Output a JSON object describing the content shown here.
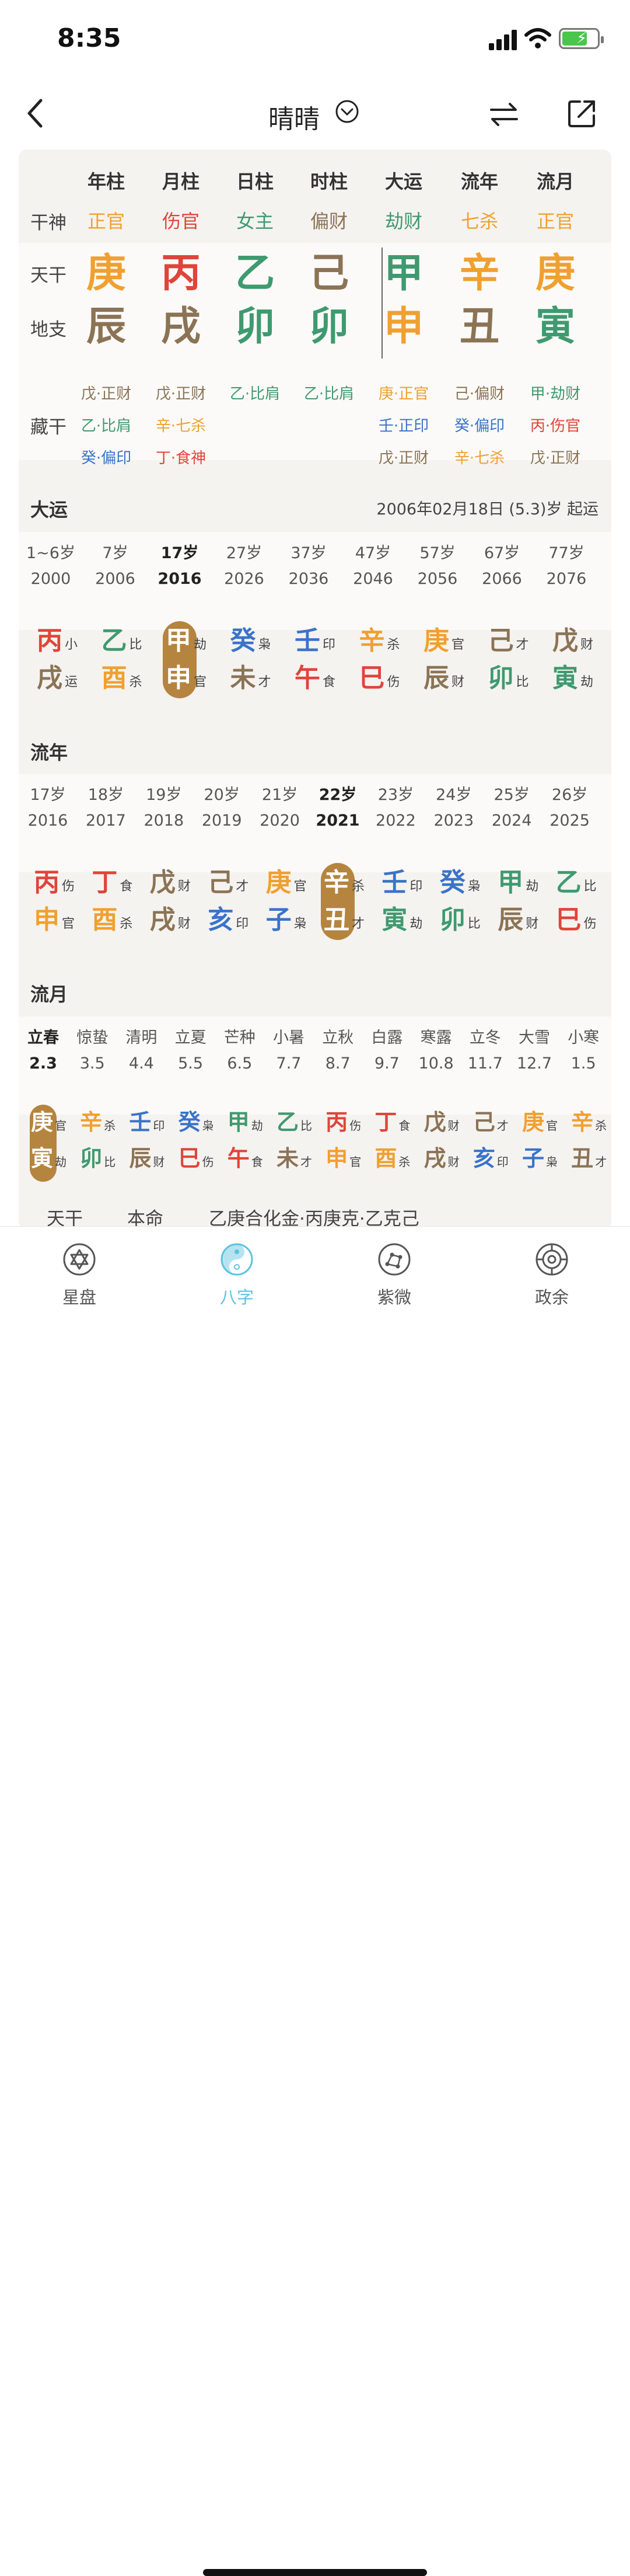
{
  "status": {
    "time": "8:35"
  },
  "header": {
    "title": "晴晴"
  },
  "colors": {
    "wood": "#3f9a6f",
    "fire": "#e0443a",
    "earth": "#8b7355",
    "metal": "#f0a030",
    "water": "#3a73c9",
    "accent": "#5bc4de",
    "pill": "#b5843f"
  },
  "pillars": {
    "headers": [
      "年柱",
      "月柱",
      "日柱",
      "时柱",
      "大运",
      "流年",
      "流月"
    ],
    "row_labels": {
      "shishen": "干神",
      "tiangan": "天干",
      "dizhi": "地支",
      "canggan": "藏干"
    },
    "shishen": [
      "正官",
      "伤官",
      "女主",
      "偏财",
      "劫财",
      "七杀",
      "正官"
    ],
    "tiangan": [
      "庚",
      "丙",
      "乙",
      "己",
      "甲",
      "辛",
      "庚"
    ],
    "dizhi": [
      "辰",
      "戌",
      "卯",
      "卯",
      "申",
      "丑",
      "寅"
    ],
    "canggan": [
      [
        "戊·正财",
        "乙·比肩",
        "癸·偏印"
      ],
      [
        "戊·正财",
        "辛·七杀",
        "丁·食神"
      ],
      [
        "乙·比肩"
      ],
      [
        "乙·比肩"
      ],
      [
        "庚·正官",
        "壬·正印",
        "戊·正财"
      ],
      [
        "己·偏财",
        "癸·偏印",
        "辛·七杀"
      ],
      [
        "甲·劫财",
        "丙·伤官",
        "戊·正财"
      ]
    ]
  },
  "dayun": {
    "title": "大运",
    "start_info": "2006年02月18日 (5.3)岁 起运",
    "ages": [
      "1~6岁",
      "7岁",
      "17岁",
      "27岁",
      "37岁",
      "47岁",
      "57岁",
      "67岁",
      "77岁"
    ],
    "years": [
      "2000",
      "2006",
      "2016",
      "2026",
      "2036",
      "2046",
      "2056",
      "2066",
      "2076"
    ],
    "current_index": 2,
    "items": [
      {
        "g": "丙",
        "gt": "小",
        "z": "戌",
        "zt": "运"
      },
      {
        "g": "乙",
        "gt": "比",
        "z": "酉",
        "zt": "杀"
      },
      {
        "g": "甲",
        "gt": "劫",
        "z": "申",
        "zt": "官"
      },
      {
        "g": "癸",
        "gt": "枭",
        "z": "未",
        "zt": "才"
      },
      {
        "g": "壬",
        "gt": "印",
        "z": "午",
        "zt": "食"
      },
      {
        "g": "辛",
        "gt": "杀",
        "z": "巳",
        "zt": "伤"
      },
      {
        "g": "庚",
        "gt": "官",
        "z": "辰",
        "zt": "财"
      },
      {
        "g": "己",
        "gt": "才",
        "z": "卯",
        "zt": "比"
      },
      {
        "g": "戊",
        "gt": "财",
        "z": "寅",
        "zt": "劫"
      }
    ]
  },
  "liunian": {
    "title": "流年",
    "ages": [
      "17岁",
      "18岁",
      "19岁",
      "20岁",
      "21岁",
      "22岁",
      "23岁",
      "24岁",
      "25岁",
      "26岁"
    ],
    "years": [
      "2016",
      "2017",
      "2018",
      "2019",
      "2020",
      "2021",
      "2022",
      "2023",
      "2024",
      "2025"
    ],
    "current_index": 5,
    "items": [
      {
        "g": "丙",
        "gt": "伤",
        "z": "申",
        "zt": "官"
      },
      {
        "g": "丁",
        "gt": "食",
        "z": "酉",
        "zt": "杀"
      },
      {
        "g": "戊",
        "gt": "财",
        "z": "戌",
        "zt": "财"
      },
      {
        "g": "己",
        "gt": "才",
        "z": "亥",
        "zt": "印"
      },
      {
        "g": "庚",
        "gt": "官",
        "z": "子",
        "zt": "枭"
      },
      {
        "g": "辛",
        "gt": "杀",
        "z": "丑",
        "zt": "才"
      },
      {
        "g": "壬",
        "gt": "印",
        "z": "寅",
        "zt": "劫"
      },
      {
        "g": "癸",
        "gt": "枭",
        "z": "卯",
        "zt": "比"
      },
      {
        "g": "甲",
        "gt": "劫",
        "z": "辰",
        "zt": "财"
      },
      {
        "g": "乙",
        "gt": "比",
        "z": "巳",
        "zt": "伤"
      }
    ]
  },
  "liuyue": {
    "title": "流月",
    "terms": [
      "立春",
      "惊蛰",
      "清明",
      "立夏",
      "芒种",
      "小暑",
      "立秋",
      "白露",
      "寒露",
      "立冬",
      "大雪",
      "小寒"
    ],
    "dates": [
      "2.3",
      "3.5",
      "4.4",
      "5.5",
      "6.5",
      "7.7",
      "8.7",
      "9.7",
      "10.8",
      "11.7",
      "12.7",
      "1.5"
    ],
    "current_index": 0,
    "items": [
      {
        "g": "庚",
        "gt": "官",
        "z": "寅",
        "zt": "劫"
      },
      {
        "g": "辛",
        "gt": "杀",
        "z": "卯",
        "zt": "比"
      },
      {
        "g": "壬",
        "gt": "印",
        "z": "辰",
        "zt": "财"
      },
      {
        "g": "癸",
        "gt": "枭",
        "z": "巳",
        "zt": "伤"
      },
      {
        "g": "甲",
        "gt": "劫",
        "z": "午",
        "zt": "食"
      },
      {
        "g": "乙",
        "gt": "比",
        "z": "未",
        "zt": "才"
      },
      {
        "g": "丙",
        "gt": "伤",
        "z": "申",
        "zt": "官"
      },
      {
        "g": "丁",
        "gt": "食",
        "z": "酉",
        "zt": "杀"
      },
      {
        "g": "戊",
        "gt": "财",
        "z": "戌",
        "zt": "财"
      },
      {
        "g": "己",
        "gt": "才",
        "z": "亥",
        "zt": "印"
      },
      {
        "g": "庚",
        "gt": "官",
        "z": "子",
        "zt": "枭"
      },
      {
        "g": "辛",
        "gt": "杀",
        "z": "丑",
        "zt": "才"
      }
    ]
  },
  "footer_row": {
    "label1": "天干",
    "label2": "本命",
    "text": "乙庚合化金·丙庚克·乙克己"
  },
  "tabs": [
    {
      "label": "星盘",
      "icon": "star-of-david-icon"
    },
    {
      "label": "八字",
      "icon": "yin-yang-icon"
    },
    {
      "label": "紫微",
      "icon": "constellation-icon"
    },
    {
      "label": "政余",
      "icon": "dharma-wheel-icon"
    }
  ],
  "active_tab": 1
}
